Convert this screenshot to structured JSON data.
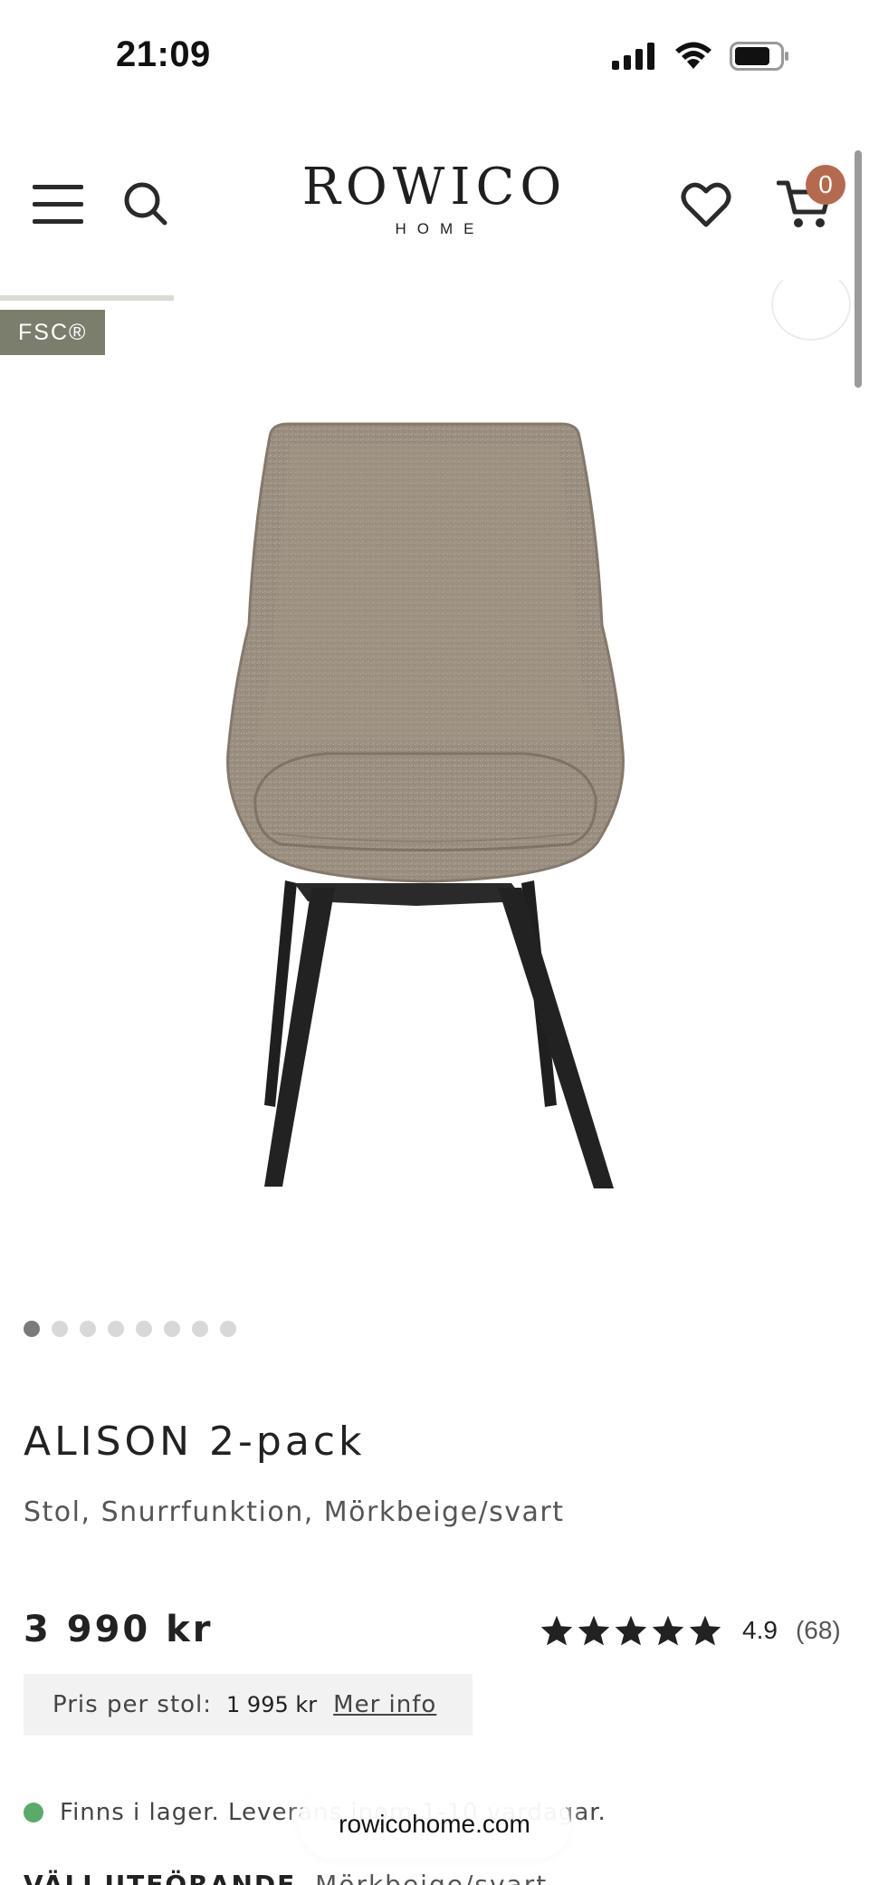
{
  "status_bar": {
    "time": "21:09"
  },
  "header": {
    "logo_main": "ROWICO",
    "logo_sub": "HOME",
    "cart_count": "0"
  },
  "gallery": {
    "badge": "FSC®",
    "image_count": 8,
    "active_index": 0
  },
  "product": {
    "title": "ALISON 2-pack",
    "subtitle": "Stol, Snurrfunktion, Mörkbeige/svart",
    "price": "3 990 kr",
    "rating_value": "4.9",
    "rating_count": "(68)",
    "rating_stars": 5,
    "per_chair_label": "Pris per stol:",
    "per_chair_value": "1 995 kr",
    "per_chair_link": "Mer info",
    "stock_text": "Finns i lager. Leverans inom 1-10 vardagar.",
    "variant_label": "VÄLJ UTFÖRANDE",
    "variant_value": "Mörkbeige/svart"
  },
  "browser": {
    "url": "rowicohome.com"
  },
  "colors": {
    "badge_bg": "#7b7e6d",
    "cart_badge_bg": "#b56a4f",
    "in_stock": "#5aaa6a",
    "fabric": "#9a8e80",
    "legs": "#1f1f1f"
  }
}
